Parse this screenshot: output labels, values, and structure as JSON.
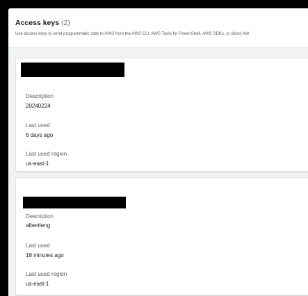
{
  "section": {
    "title": "Access keys",
    "count": "(2)",
    "description": "Use access keys to send programmatic calls to AWS from the AWS CLI, AWS Tools for PowerShell, AWS SDKs, or direct AW"
  },
  "keys": [
    {
      "description_label": "Description",
      "description": "20240224",
      "last_used_label": "Last used",
      "last_used": "6 days ago",
      "region_label": "Last used region",
      "region": "us-east-1"
    },
    {
      "description_label": "Description",
      "description": "albertleng",
      "last_used_label": "Last used",
      "last_used": "18 minutes ago",
      "region_label": "Last used region",
      "region": "us-east-1"
    }
  ],
  "colors": {
    "background": "#000000",
    "panel": "#f2f3f3",
    "card": "#ffffff",
    "text_primary": "#16191f",
    "text_secondary": "#545b64",
    "redaction": "#000000"
  }
}
